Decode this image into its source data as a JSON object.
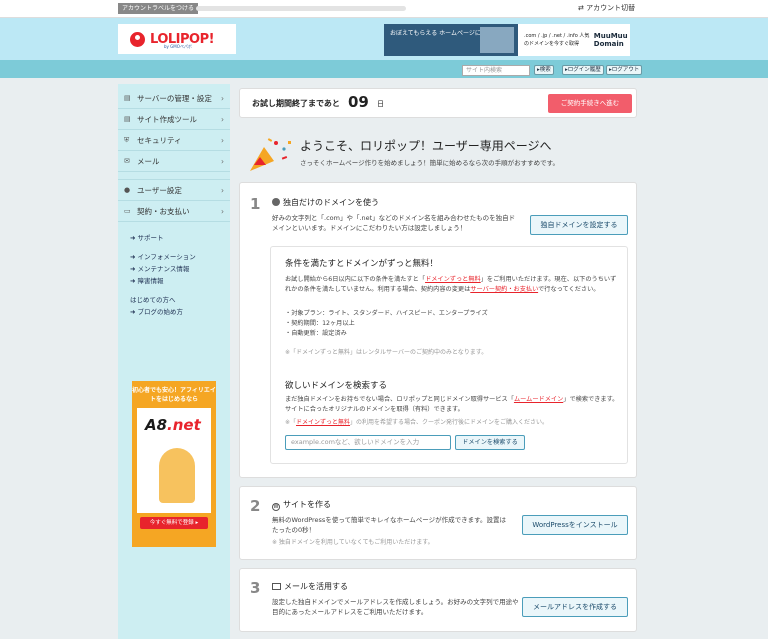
{
  "topbar": {
    "label_button": "アカウントラベルをつける",
    "account_switch": "⇄ アカウント切替"
  },
  "header": {
    "logo_text": "LOLIPOP!",
    "logo_sub": "by GMOペパボ",
    "banner_left": "おぼえてもらえる ホームページにしよう。",
    "banner_right_text": ".com / .jp / .net / .info 人気のドメインを今すぐ取得",
    "banner_brand": "MuuMuu Domain"
  },
  "nav": {
    "search_placeholder": "サイト内検索",
    "search_btn": "▸検索",
    "login_history": "▸ログイン履歴",
    "logout": "▸ログアウト"
  },
  "sidebar": {
    "items": [
      {
        "icon": "server-icon",
        "label": "サーバーの管理・設定"
      },
      {
        "icon": "tools-icon",
        "label": "サイト作成ツール"
      },
      {
        "icon": "shield-icon",
        "label": "セキュリティ"
      },
      {
        "icon": "mail-icon",
        "label": "メール"
      },
      {
        "icon": "user-icon",
        "label": "ユーザー設定"
      },
      {
        "icon": "card-icon",
        "label": "契約・お支払い"
      }
    ],
    "links": [
      "サポート",
      "インフォメーション",
      "メンテナンス情報",
      "障害情報",
      "はじめての方へ",
      "ブログの始め方"
    ],
    "ad": {
      "headline": "初心者でも安心！アフィリエイトをはじめるなら",
      "brand": "A8",
      "brand_suffix": ".net",
      "cta": "今すぐ無料で登録 ▸"
    }
  },
  "trial": {
    "label": "お試し期間終了まであと",
    "days": "09",
    "unit": "日",
    "button": "ご契約手続きへ進む"
  },
  "welcome": {
    "title": "ようこそ、ロリポップ！ユーザー専用ページへ",
    "subtitle": "さっそくホームページ作りを始めましょう！簡単に始めるなら次の手順がおすすめです。"
  },
  "step1": {
    "num": "1",
    "title": "独自だけのドメインを使う",
    "desc": "好みの文字列と「.com」や「.net」などのドメイン名を組み合わせたものを独自ドメインといいます。ドメインにこだわりたい方は設定しましょう！",
    "button": "独自ドメインを設定する",
    "inner": {
      "heading": "条件を満たすとドメインがずっと無料！",
      "p1a": "お試し開始から6日以内に以下の条件を満たすと「",
      "p1link": "ドメインずっと無料",
      "p1b": "」をご利用いただけます。現在、以下のうちいずれかの条件を満たしていません。利用する場合、契約内容の変更は",
      "p1link2": "サーバー契約・お支払い",
      "p1c": "で行なってください。",
      "conditions": [
        "対象プラン：ライト、スタンダード、ハイスピード、エンタープライズ",
        "契約期間：12ヶ月以上",
        "自動更新：設定済み"
      ],
      "note1": "※「ドメインずっと無料」はレンタルサーバーのご契約中のみとなります。",
      "search_heading": "欲しいドメインを検索する",
      "p2a": "まだ独自ドメインをお持ちでない場合、ロリポップと同じドメイン取得サービス「",
      "p2link": "ムームードメイン",
      "p2b": "」で検索できます。サイトに合ったオリジナルのドメインを取得（有料）できます。",
      "note2a": "※「",
      "note2link": "ドメインずっと無料",
      "note2b": "」の利用を希望する場合、クーポン発行後にドメインをご購入ください。",
      "search_placeholder": "example.comなど、欲しいドメインを入力",
      "search_button": "ドメインを検索する"
    }
  },
  "step2": {
    "num": "2",
    "title": "サイトを作る",
    "desc": "無料のWordPressを使って簡単でキレイなホームページが作成できます。設置はたったの0秒！",
    "note": "※ 独自ドメインを利用していなくてもご利用いただけます。",
    "button": "WordPressをインストール"
  },
  "step3": {
    "num": "3",
    "title": "メールを活用する",
    "desc": "設定した独自ドメインでメールアドレスを作成しましょう。お好みの文字列で用途や目的にあったメールアドレスをご利用いただけます。",
    "button": "メールアドレスを作成する"
  }
}
